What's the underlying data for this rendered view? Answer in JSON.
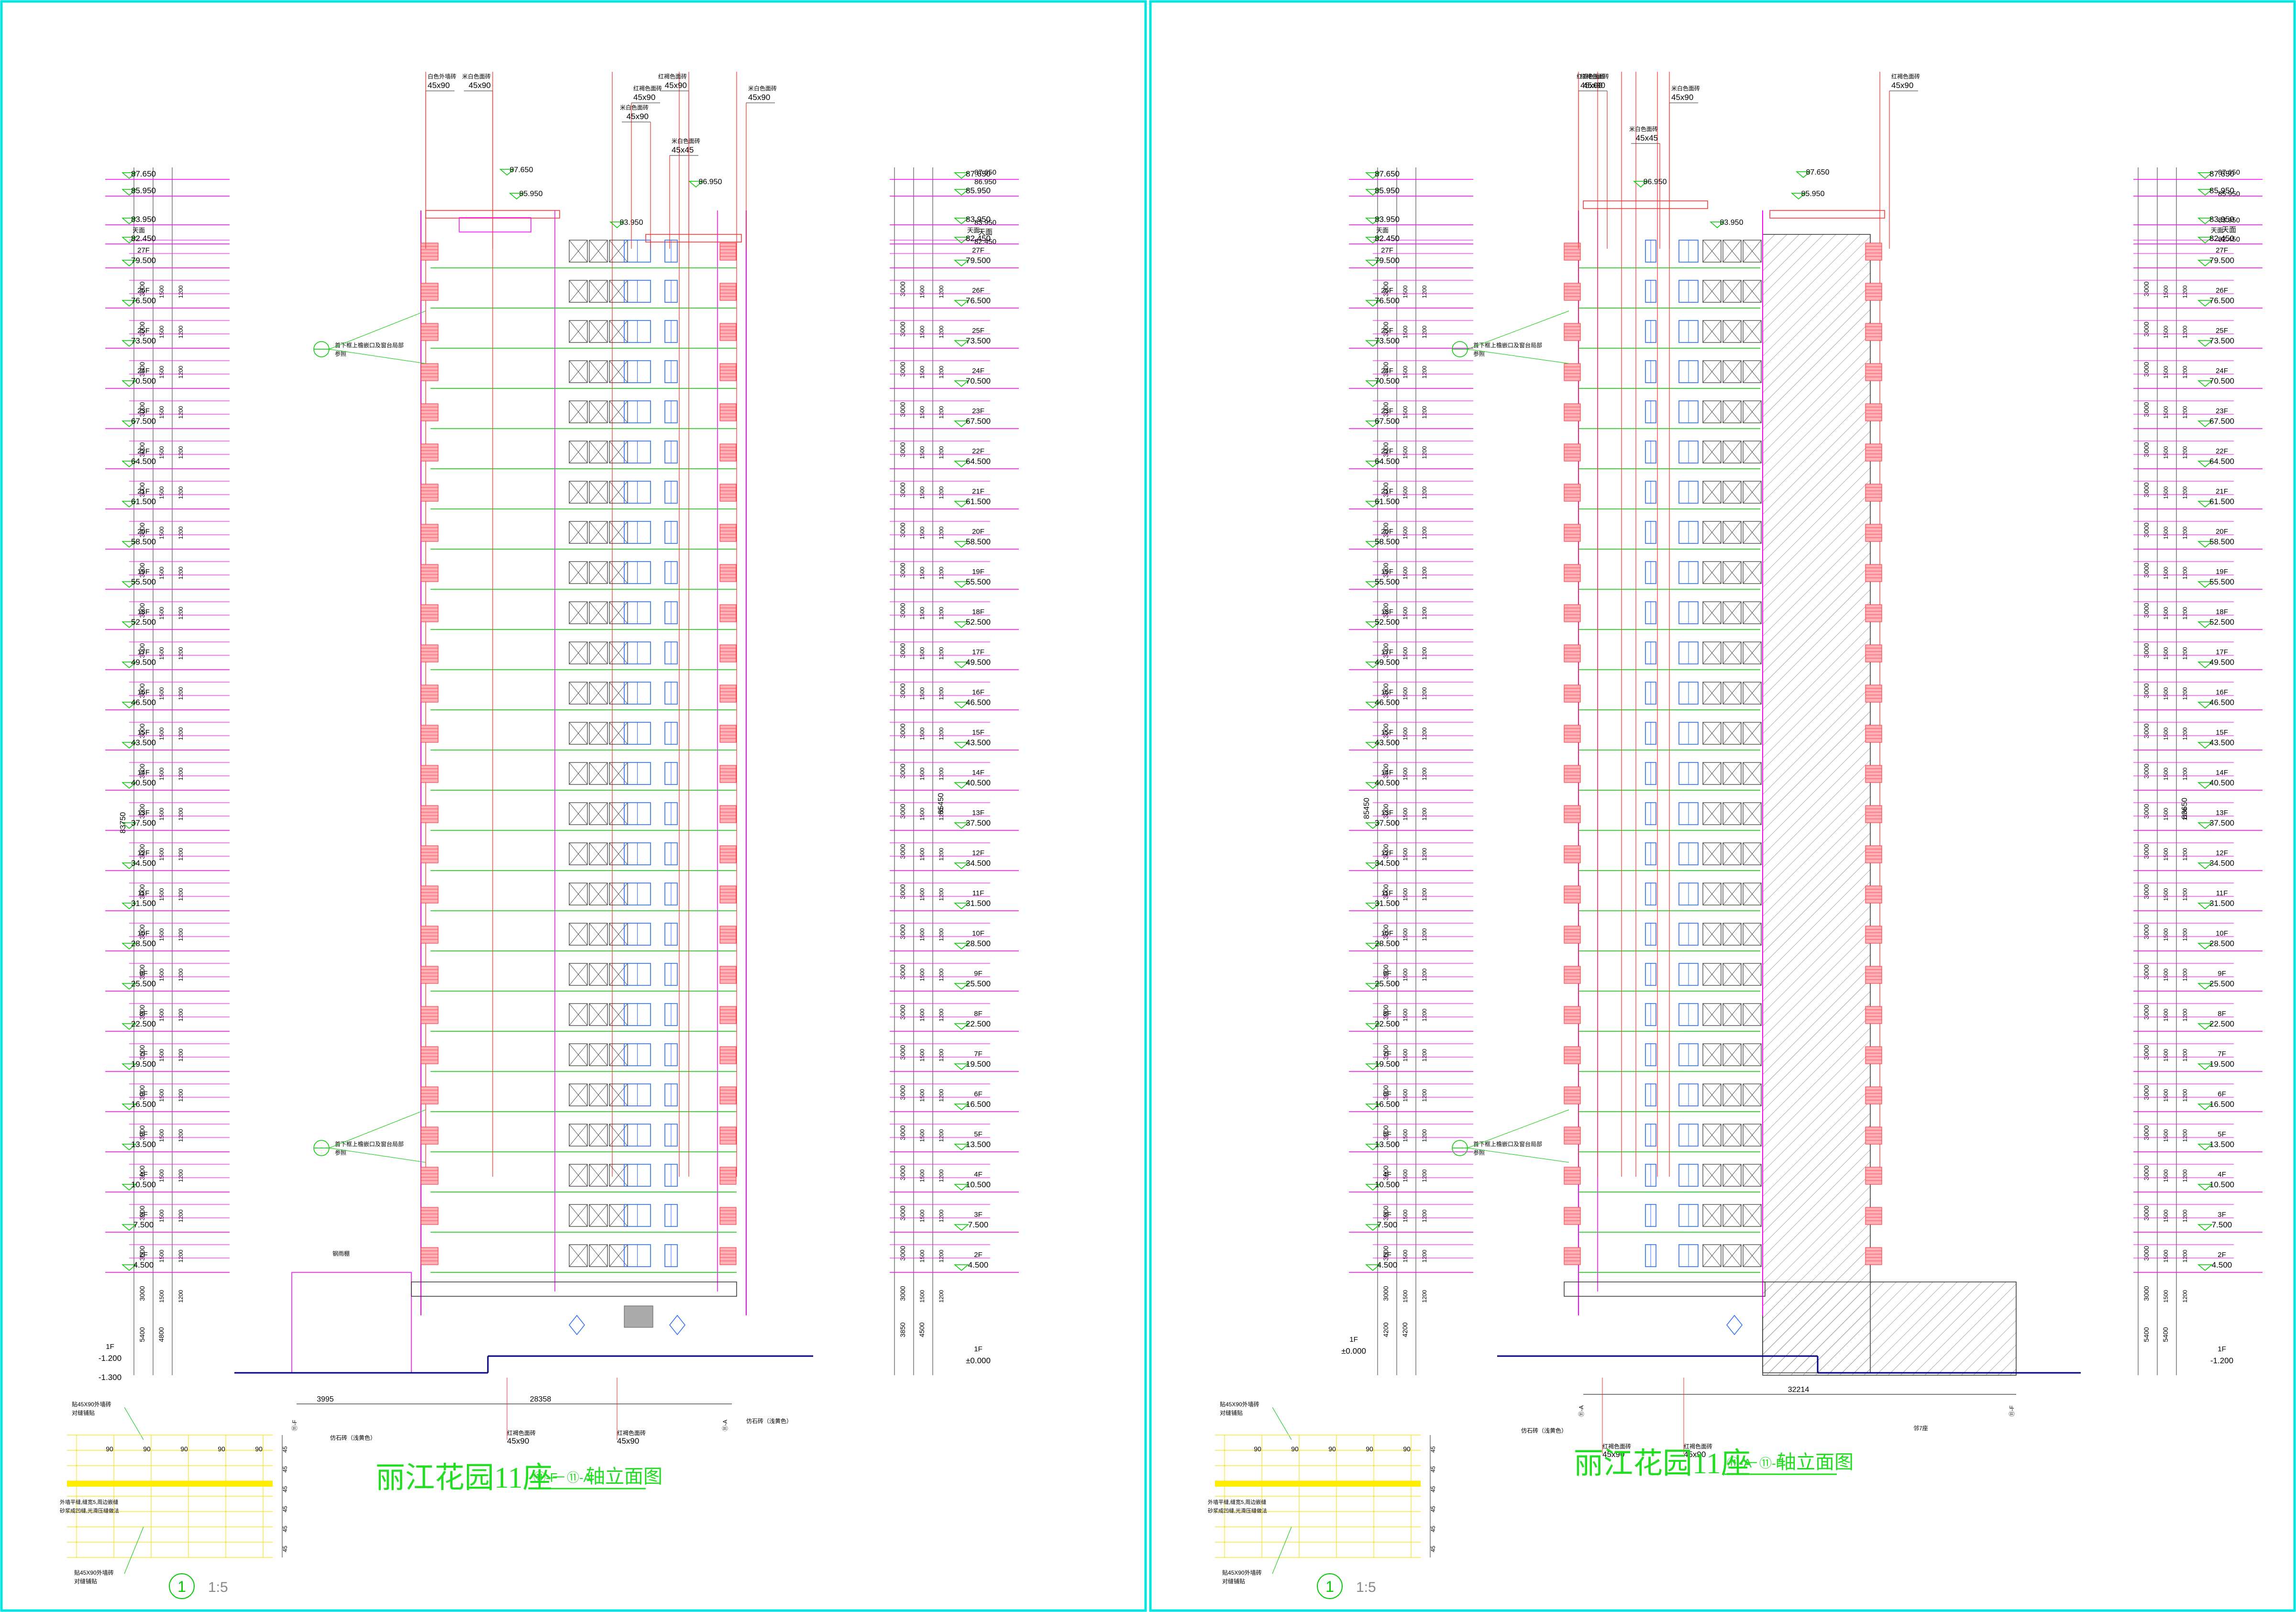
{
  "colors": {
    "frame": "#00e5e5",
    "floor_line": "#00cc00",
    "magenta": "#ff00ff",
    "red": "#ff2a2a",
    "pink": "#ffb0b8",
    "blue": "#2a6cff",
    "ground": "#000080",
    "yellow": "#ffee00",
    "grid": "#f5e642",
    "text": "#000000",
    "title": "#22dd22"
  },
  "floors": [
    {
      "label": "27F",
      "elev": "79.500"
    },
    {
      "label": "26F",
      "elev": "76.500"
    },
    {
      "label": "25F",
      "elev": "73.500"
    },
    {
      "label": "24F",
      "elev": "70.500"
    },
    {
      "label": "23F",
      "elev": "67.500"
    },
    {
      "label": "22F",
      "elev": "64.500"
    },
    {
      "label": "21F",
      "elev": "61.500"
    },
    {
      "label": "20F",
      "elev": "58.500"
    },
    {
      "label": "19F",
      "elev": "55.500"
    },
    {
      "label": "18F",
      "elev": "52.500"
    },
    {
      "label": "17F",
      "elev": "49.500"
    },
    {
      "label": "16F",
      "elev": "46.500"
    },
    {
      "label": "15F",
      "elev": "43.500"
    },
    {
      "label": "14F",
      "elev": "40.500"
    },
    {
      "label": "13F",
      "elev": "37.500"
    },
    {
      "label": "12F",
      "elev": "34.500"
    },
    {
      "label": "11F",
      "elev": "31.500"
    },
    {
      "label": "10F",
      "elev": "28.500"
    },
    {
      "label": "9F",
      "elev": "25.500"
    },
    {
      "label": "8F",
      "elev": "22.500"
    },
    {
      "label": "7F",
      "elev": "19.500"
    },
    {
      "label": "6F",
      "elev": "16.500"
    },
    {
      "label": "5F",
      "elev": "13.500"
    },
    {
      "label": "4F",
      "elev": "10.500"
    },
    {
      "label": "3F",
      "elev": "7.500"
    },
    {
      "label": "2F",
      "elev": "4.500"
    }
  ],
  "top_levels": [
    {
      "label": "",
      "elev": "87.650"
    },
    {
      "label": "",
      "elev": "85.950"
    },
    {
      "label": "",
      "elev": "83.950"
    },
    {
      "label": "天面",
      "elev": "82.450"
    }
  ],
  "left_sheet": {
    "title": "丽江花园11座",
    "axis_from": "⑪-F",
    "axis_to": "⑪-A",
    "title_suffix": "轴立面图",
    "ground_label": "1F",
    "ground_elevs": [
      "-1.200",
      "-1.300"
    ],
    "right_ground_label": "1F",
    "right_ground_elev": "±0.000",
    "total_dim": "83750",
    "right_total_dim": "85450",
    "base_dims": [
      "5400",
      "4800"
    ],
    "right_base_dims": [
      "3850",
      "4500"
    ],
    "bottom_dims": [
      "3995",
      "28358"
    ],
    "axis_marks": [
      "⑪-F",
      "⑪-A"
    ],
    "roof_elevs": [
      "87.650",
      "85.950",
      "83.950",
      "86.950"
    ],
    "right_top_elevs": [
      "87.650",
      "86.950",
      "83.950",
      "天面",
      "82.450"
    ],
    "callouts_top": [
      {
        "line1": "白色外墙砖",
        "line2": "45x90"
      },
      {
        "line1": "米白色面砖",
        "line2": "45x90"
      },
      {
        "line1": "红褐色面砖",
        "line2": "45x90"
      },
      {
        "line1": "米白色面砖",
        "line2": "45x90"
      },
      {
        "line1": "米白色面砖",
        "line2": "45x45"
      },
      {
        "line1": "红褐色面砖",
        "line2": "45x90"
      },
      {
        "line1": "米白色面砖",
        "line2": "45x90"
      }
    ],
    "side_note_1": "首下框上檐嵌口及窗台局部",
    "side_note_1b": "参照",
    "side_note_2": "首下框上檐嵌口及窗台局部",
    "side_note_2b": "参照",
    "bottom_callouts": [
      {
        "line1": "红褐色面砖",
        "line2": "45x90"
      },
      {
        "line1": "红褐色面砖",
        "line2": "45x90"
      }
    ],
    "bottom_note_left": "仿石砖（浅黄色）",
    "bottom_note_right": "仿石砖（浅黄色）",
    "canopy_note": "钢雨棚"
  },
  "right_sheet": {
    "title": "丽江花园11座",
    "axis_from": "⑪-A",
    "axis_to": "⑪-F",
    "title_suffix": "轴立面图",
    "ground_label": "1F",
    "ground_elev": "±0.000",
    "right_ground_label": "1F",
    "right_ground_elev": "-1.200",
    "total_dim": "85450",
    "right_total_dim": "83650",
    "base_dims": [
      "4200",
      "4200"
    ],
    "right_base_dims": [
      "5400",
      "5400"
    ],
    "bottom_dim": "32214",
    "axis_marks": [
      "⑪-A",
      "⑪-F"
    ],
    "roof_elevs": [
      "87.650",
      "85.950",
      "86.950",
      "83.950"
    ],
    "right_top_elevs": [
      "87.650",
      "85.950",
      "83.950",
      "天面",
      "82.450"
    ],
    "callouts_top": [
      {
        "line1": "红褐色面砖",
        "line2": "45x90"
      },
      {
        "line1": "红褐色面砖",
        "line2": "45x90"
      },
      {
        "line1": "米白色面砖",
        "line2": "45x90"
      },
      {
        "line1": "米白色面砖",
        "line2": "45x45"
      },
      {
        "line1": "红褐色面砖",
        "line2": "45x90"
      }
    ],
    "side_note_1": "首下框上檐嵌口及窗台局部",
    "side_note_1b": "参照",
    "side_note_2": "首下框上檐嵌口及窗台局部",
    "side_note_2b": "参照",
    "bottom_callouts": [
      {
        "line1": "红褐色面砖",
        "line2": "45x90"
      },
      {
        "line1": "红褐色面砖",
        "line2": "45x90"
      }
    ],
    "bottom_note_left": "仿石砖（浅黄色）",
    "bottom_note_right": "邻7座"
  },
  "detail": {
    "note_top": "贴45X90外墙砖",
    "note_top2": "对缝铺贴",
    "col_dims": [
      "90",
      "90",
      "90",
      "90",
      "90"
    ],
    "row_dims": [
      "45",
      "45",
      "45",
      "45",
      "45",
      "45"
    ],
    "strip_note": "外墙平缝,缝宽5,周边嵌缝",
    "strip_note2": "砂浆成凹缝,光滑压缝做法",
    "note_bottom": "贴45X90外墙砖",
    "note_bottom2": "对缝铺贴",
    "mark": "1",
    "scale": "1:5"
  }
}
